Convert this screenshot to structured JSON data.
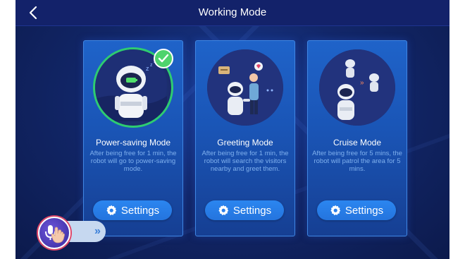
{
  "header": {
    "title": "Working Mode",
    "back_icon": "chevron-left-icon"
  },
  "modes": [
    {
      "name": "Power-saving Mode",
      "description": "After being free for 1 min, the robot will go to power-saving mode.",
      "settings_label": "Settings",
      "selected": true
    },
    {
      "name": "Greeting Mode",
      "description": "After being free for 1 min, the robot will search the visitors nearby and greet them.",
      "settings_label": "Settings",
      "selected": false
    },
    {
      "name": "Cruise Mode",
      "description": "After being free for 5 mins, the robot will patrol the area for 5 mins.",
      "settings_label": "Settings",
      "selected": false
    }
  ],
  "colors": {
    "accent": "#2b86f0",
    "selected_ring": "#2ecc71",
    "card": "#1f63c9",
    "background": "#12276a",
    "description_text": "#7fb0ee"
  },
  "icons": {
    "settings": "gear-icon",
    "selected": "checkmark-icon",
    "voice": "microphone-icon",
    "expand": "double-chevron-right-icon"
  }
}
